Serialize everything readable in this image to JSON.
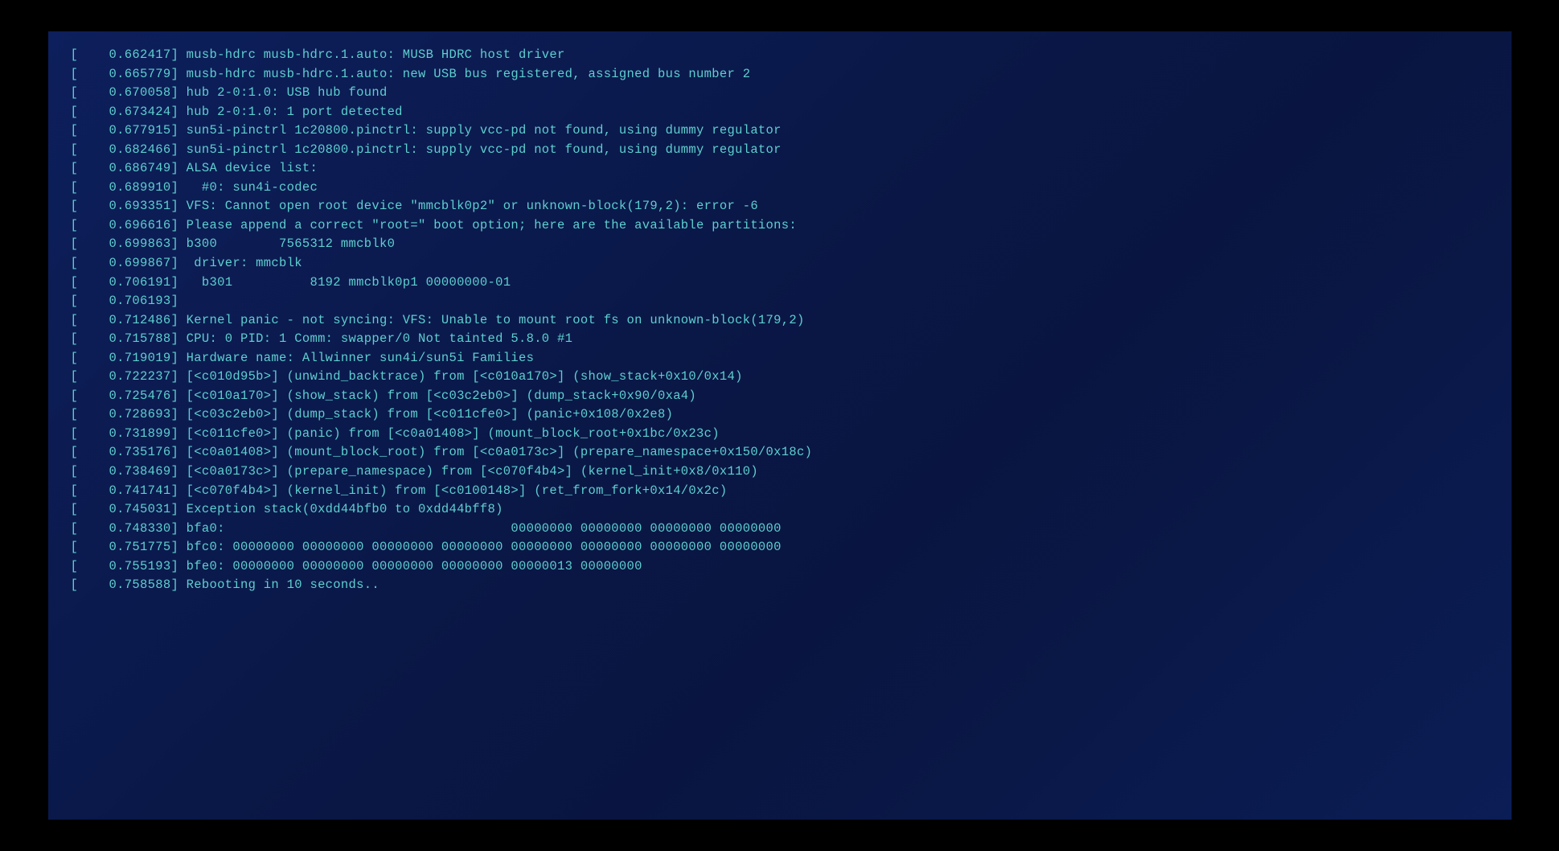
{
  "screen": {
    "bg_color": "#0a1848",
    "text_color": "#5ecfcf",
    "lines": [
      "[    0.662417] musb-hdrc musb-hdrc.1.auto: MUSB HDRC host driver",
      "[    0.665779] musb-hdrc musb-hdrc.1.auto: new USB bus registered, assigned bus number 2",
      "[    0.670058] hub 2-0:1.0: USB hub found",
      "[    0.673424] hub 2-0:1.0: 1 port detected",
      "[    0.677915] sun5i-pinctrl 1c20800.pinctrl: supply vcc-pd not found, using dummy regulator",
      "[    0.682466] sun5i-pinctrl 1c20800.pinctrl: supply vcc-pd not found, using dummy regulator",
      "[    0.686749] ALSA device list:",
      "[    0.689910]   #0: sun4i-codec",
      "[    0.693351] VFS: Cannot open root device \"mmcblk0p2\" or unknown-block(179,2): error -6",
      "[    0.696616] Please append a correct \"root=\" boot option; here are the available partitions:",
      "[    0.699863] b300        7565312 mmcblk0",
      "[    0.699867]  driver: mmcblk",
      "[    0.706191]   b301          8192 mmcblk0p1 00000000-01",
      "[    0.706193] ",
      "[    0.712486] Kernel panic - not syncing: VFS: Unable to mount root fs on unknown-block(179,2)",
      "[    0.715788] CPU: 0 PID: 1 Comm: swapper/0 Not tainted 5.8.0 #1",
      "[    0.719019] Hardware name: Allwinner sun4i/sun5i Families",
      "[    0.722237] [<c010d95b>] (unwind_backtrace) from [<c010a170>] (show_stack+0x10/0x14)",
      "[    0.725476] [<c010a170>] (show_stack) from [<c03c2eb0>] (dump_stack+0x90/0xa4)",
      "[    0.728693] [<c03c2eb0>] (dump_stack) from [<c011cfe0>] (panic+0x108/0x2e8)",
      "[    0.731899] [<c011cfe0>] (panic) from [<c0a01408>] (mount_block_root+0x1bc/0x23c)",
      "[    0.735176] [<c0a01408>] (mount_block_root) from [<c0a0173c>] (prepare_namespace+0x150/0x18c)",
      "[    0.738469] [<c0a0173c>] (prepare_namespace) from [<c070f4b4>] (kernel_init+0x8/0x110)",
      "[    0.741741] [<c070f4b4>] (kernel_init) from [<c0100148>] (ret_from_fork+0x14/0x2c)",
      "[    0.745031] Exception stack(0xdd44bfb0 to 0xdd44bff8)",
      "[    0.748330] bfa0:                                     00000000 00000000 00000000 00000000",
      "[    0.751775] bfc0: 00000000 00000000 00000000 00000000 00000000 00000000 00000000 00000000",
      "[    0.755193] bfe0: 00000000 00000000 00000000 00000000 00000013 00000000",
      "[    0.758588] Rebooting in 10 seconds.."
    ]
  }
}
